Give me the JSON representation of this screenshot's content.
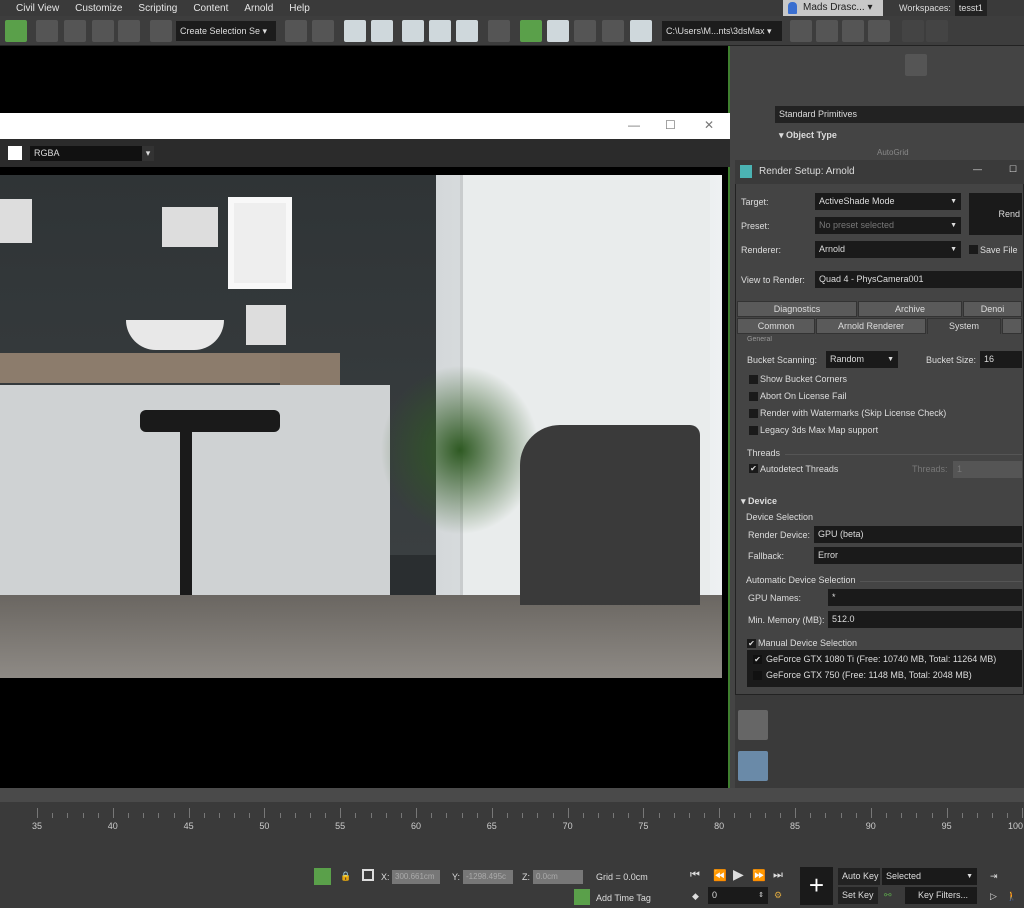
{
  "menu": [
    "Civil View",
    "Customize",
    "Scripting",
    "Content",
    "Arnold",
    "Help"
  ],
  "user": "Mads Drasc...",
  "workspaces_label": "Workspaces:",
  "workspace": "tesst1",
  "toolbar": {
    "selection_set": "Create Selection Se",
    "path": "C:\\Users\\M...nts\\3dsMax"
  },
  "framebuffer": {
    "channel": "RGBA"
  },
  "command_panel": {
    "category": "Standard Primitives",
    "rollout": "Object Type",
    "autogrid": "AutoGrid"
  },
  "render_setup": {
    "title": "Render Setup: Arnold",
    "target_label": "Target:",
    "target": "ActiveShade Mode",
    "preset_label": "Preset:",
    "preset": "No preset selected",
    "renderer_label": "Renderer:",
    "renderer": "Arnold",
    "save_file": "Save File",
    "render_button": "Rend",
    "view_label": "View to Render:",
    "view": "Quad 4 - PhysCamera001",
    "tabs_row1": [
      "Diagnostics",
      "Archive",
      "Denoi"
    ],
    "tabs_row2": [
      "Common",
      "Arnold Renderer",
      "System"
    ],
    "general": "General",
    "bucket_scanning_label": "Bucket Scanning:",
    "bucket_scanning": "Random",
    "bucket_size_label": "Bucket Size:",
    "bucket_size": "16",
    "options": [
      {
        "label": "Show Bucket Corners",
        "checked": false
      },
      {
        "label": "Abort On License Fail",
        "checked": false
      },
      {
        "label": "Render with Watermarks (Skip License Check)",
        "checked": false
      },
      {
        "label": "Legacy 3ds Max Map support",
        "checked": false
      }
    ],
    "threads_group": "Threads",
    "autodetect": "Autodetect Threads",
    "threads_label": "Threads:",
    "threads": "1",
    "device_rollout": "Device",
    "device_selection": "Device Selection",
    "render_device_label": "Render Device:",
    "render_device": "GPU (beta)",
    "fallback_label": "Fallback:",
    "fallback": "Error",
    "auto_device": "Automatic Device Selection",
    "gpu_names_label": "GPU Names:",
    "gpu_names": "*",
    "min_memory_label": "Min. Memory (MB):",
    "min_memory": "512.0",
    "manual_device": "Manual Device Selection",
    "gpus": [
      {
        "label": "GeForce GTX 1080 Ti (Free: 10740 MB, Total: 11264 MB)",
        "checked": true
      },
      {
        "label": "GeForce GTX 750 (Free: 1148 MB, Total: 2048 MB)",
        "checked": false
      }
    ]
  },
  "timeline": {
    "ticks": [
      "35",
      "40",
      "45",
      "50",
      "55",
      "60",
      "65",
      "70",
      "75",
      "80",
      "85",
      "90",
      "95",
      "100"
    ]
  },
  "status": {
    "x_label": "X:",
    "x": "300.661cm",
    "y_label": "Y:",
    "y": "-1298.495c",
    "z_label": "Z:",
    "z": "0.0cm",
    "grid": "Grid = 0.0cm",
    "add_time_tag": "Add Time Tag",
    "frame": "0",
    "auto_key": "Auto Key",
    "set_key": "Set Key",
    "key_mode": "Selected",
    "key_filters": "Key Filters..."
  },
  "colors": {
    "accent_green": "#5aa04a",
    "panel": "#444444",
    "field": "#1a1a1a"
  }
}
